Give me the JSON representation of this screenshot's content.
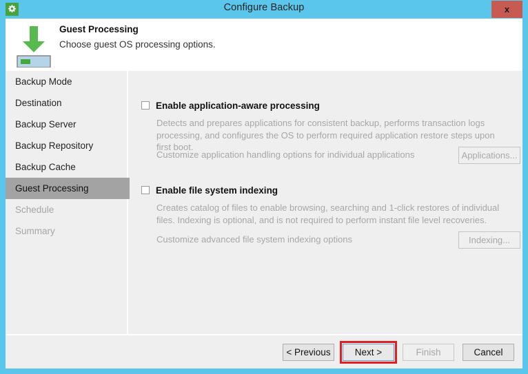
{
  "window": {
    "title": "Configure Backup",
    "app_icon": "gear-icon",
    "close_label": "x",
    "frame_color": "#5BC6EC",
    "titlebar_color": "#5BC6EC",
    "close_button_color": "#C75B52"
  },
  "header": {
    "title": "Guest Processing",
    "subtitle": "Choose guest OS processing options.",
    "icon": "green-down-arrow-to-storage-icon",
    "icon_arrow_color": "#57B94E",
    "icon_box_color": "#B6D4E8"
  },
  "sidebar": {
    "items": [
      {
        "label": "Backup Mode",
        "state": "normal"
      },
      {
        "label": "Destination",
        "state": "normal"
      },
      {
        "label": "Backup Server",
        "state": "normal"
      },
      {
        "label": "Backup Repository",
        "state": "normal"
      },
      {
        "label": "Backup Cache",
        "state": "normal"
      },
      {
        "label": "Guest Processing",
        "state": "active"
      },
      {
        "label": "Schedule",
        "state": "disabled"
      },
      {
        "label": "Summary",
        "state": "disabled"
      }
    ],
    "active_highlight_color": "#A3A3A3"
  },
  "main": {
    "options": [
      {
        "checkbox_label": "Enable application-aware processing",
        "checked": false,
        "description": "Detects and prepares applications for consistent backup, performs transaction logs processing, and configures the OS to perform required application restore steps upon first boot.",
        "customize_label": "Customize application handling options for individual applications",
        "button_label": "Applications...",
        "button_enabled": false
      },
      {
        "checkbox_label": "Enable file system indexing",
        "checked": false,
        "description": "Creates catalog of files to enable browsing, searching and 1-click restores of individual files. Indexing is optional, and is not required to perform instant file level recoveries.",
        "customize_label": "Customize advanced file system indexing options",
        "button_label": "Indexing...",
        "button_enabled": false
      }
    ]
  },
  "footer": {
    "previous_label": "< Previous",
    "next_label": "Next >",
    "finish_label": "Finish",
    "cancel_label": "Cancel",
    "next_focused": true,
    "finish_enabled": false,
    "annotation_color": "#E02020"
  }
}
